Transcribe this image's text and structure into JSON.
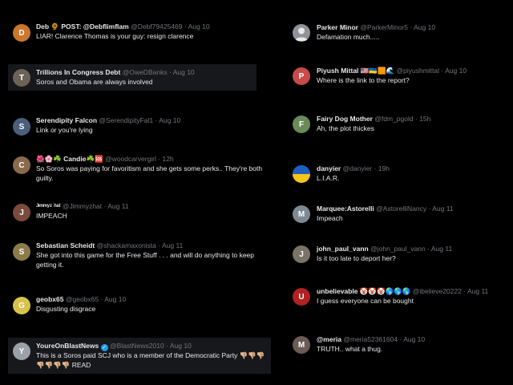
{
  "left": [
    {
      "name": "Deb 🌻 POST: @Debflimflam",
      "handle": "@Debf79425469",
      "time": "Aug 10",
      "text": "LIAR! Clarence Thomas is your guy: resign clarence",
      "avatar_color": "#c9772e",
      "avatar_label": "D"
    },
    {
      "name": "Trillions In Congress Debt",
      "handle": "@OweDBanks",
      "time": "Aug 10",
      "text": "Soros and Obama are always involved",
      "avatar_color": "#6b6356",
      "avatar_label": "T"
    },
    {
      "name": "Serendipity Falcon",
      "handle": "@SerendipityFal1",
      "time": "Aug 10",
      "text": "Link or you're lying",
      "avatar_color": "#4a5f7a",
      "avatar_label": "S"
    },
    {
      "name": "🌺🌸☘️ Candie☘️🆘",
      "handle": "@woodcarvergirl",
      "time": "12h",
      "text": "So Soros was paying for favoritism and she gets some perks.. They're both guilty.",
      "avatar_color": "#8a6a4d",
      "avatar_label": "C"
    },
    {
      "name": "ᴶᶦᵐᵐʸᶻ ʰᵃᵗ",
      "handle": "@Jimmyzhat",
      "time": "Aug 11",
      "text": "IMPEACH",
      "avatar_color": "#7a4b3a",
      "avatar_label": "J"
    },
    {
      "name": "Sebastian Scheidt",
      "handle": "@shackamaxonista",
      "time": "Aug 11",
      "text": "She got into this game for the Free Stuff . . . and will do anything to keep getting it.",
      "avatar_color": "#8b7d4a",
      "avatar_label": "S"
    },
    {
      "name": "geobx65",
      "handle": "@geobx65",
      "time": "Aug 10",
      "text": "Disgusting disgrace",
      "avatar_color": "#d9c24a",
      "avatar_label": "G"
    },
    {
      "name": "YoureOnBlastNews",
      "handle": "@BlastNews2010",
      "time": "Aug 10",
      "text": "This is a Soros paid SCJ who is a member of the Democratic Party 👎🏼👎🏼👎🏼👎🏼👎🏼👎🏼👎🏼 READ",
      "avatar_color": "#9aa1a8",
      "avatar_label": "Y"
    }
  ],
  "right": [
    {
      "name": "Parker Minor",
      "handle": "@ParkerMinor5",
      "time": "Aug 10",
      "text": "Defamation much.....",
      "avatar_color": "#8e9399",
      "avatar_label": ""
    },
    {
      "name": "Piyush Mittal 🇺🇸🇺🇦🟧🌊",
      "handle": "@piyushmittal",
      "time": "Aug 10",
      "text": "Where is the link to the report?",
      "avatar_color": "#c94a4a",
      "avatar_label": "P"
    },
    {
      "name": "Fairy Dog Mother",
      "handle": "@fdm_pgold",
      "time": "15h",
      "text": "Ah, the plot thickes",
      "avatar_color": "#6a8a5a",
      "avatar_label": "F"
    },
    {
      "name": "danyier",
      "handle": "@danyier",
      "time": "19h",
      "text": "L.I.A.R.",
      "avatar_color": "#1f5fbf",
      "avatar_label": ""
    },
    {
      "name": "Marquee:Astorelli",
      "handle": "@AstorelliNancy",
      "time": "Aug 11",
      "text": "Impeach",
      "avatar_color": "#7d8a94",
      "avatar_label": "M"
    },
    {
      "name": "john_paul_vann",
      "handle": "@john_paul_vann",
      "time": "Aug 11",
      "text": "Is it too late to deport her?",
      "avatar_color": "#7a7466",
      "avatar_label": "J"
    },
    {
      "name": "unbelievable 🤡🤡🤡🌎🌎🌎",
      "handle": "@ibelieve20222",
      "time": "Aug 11",
      "text": "I guess everyone can be bought",
      "avatar_color": "#b22222",
      "avatar_label": "U"
    },
    {
      "name": "@meria",
      "handle": "@meria52361604",
      "time": "Aug 10",
      "text": "TRUTH.. what a thug.",
      "avatar_color": "#6b5a55",
      "avatar_label": "M"
    }
  ]
}
